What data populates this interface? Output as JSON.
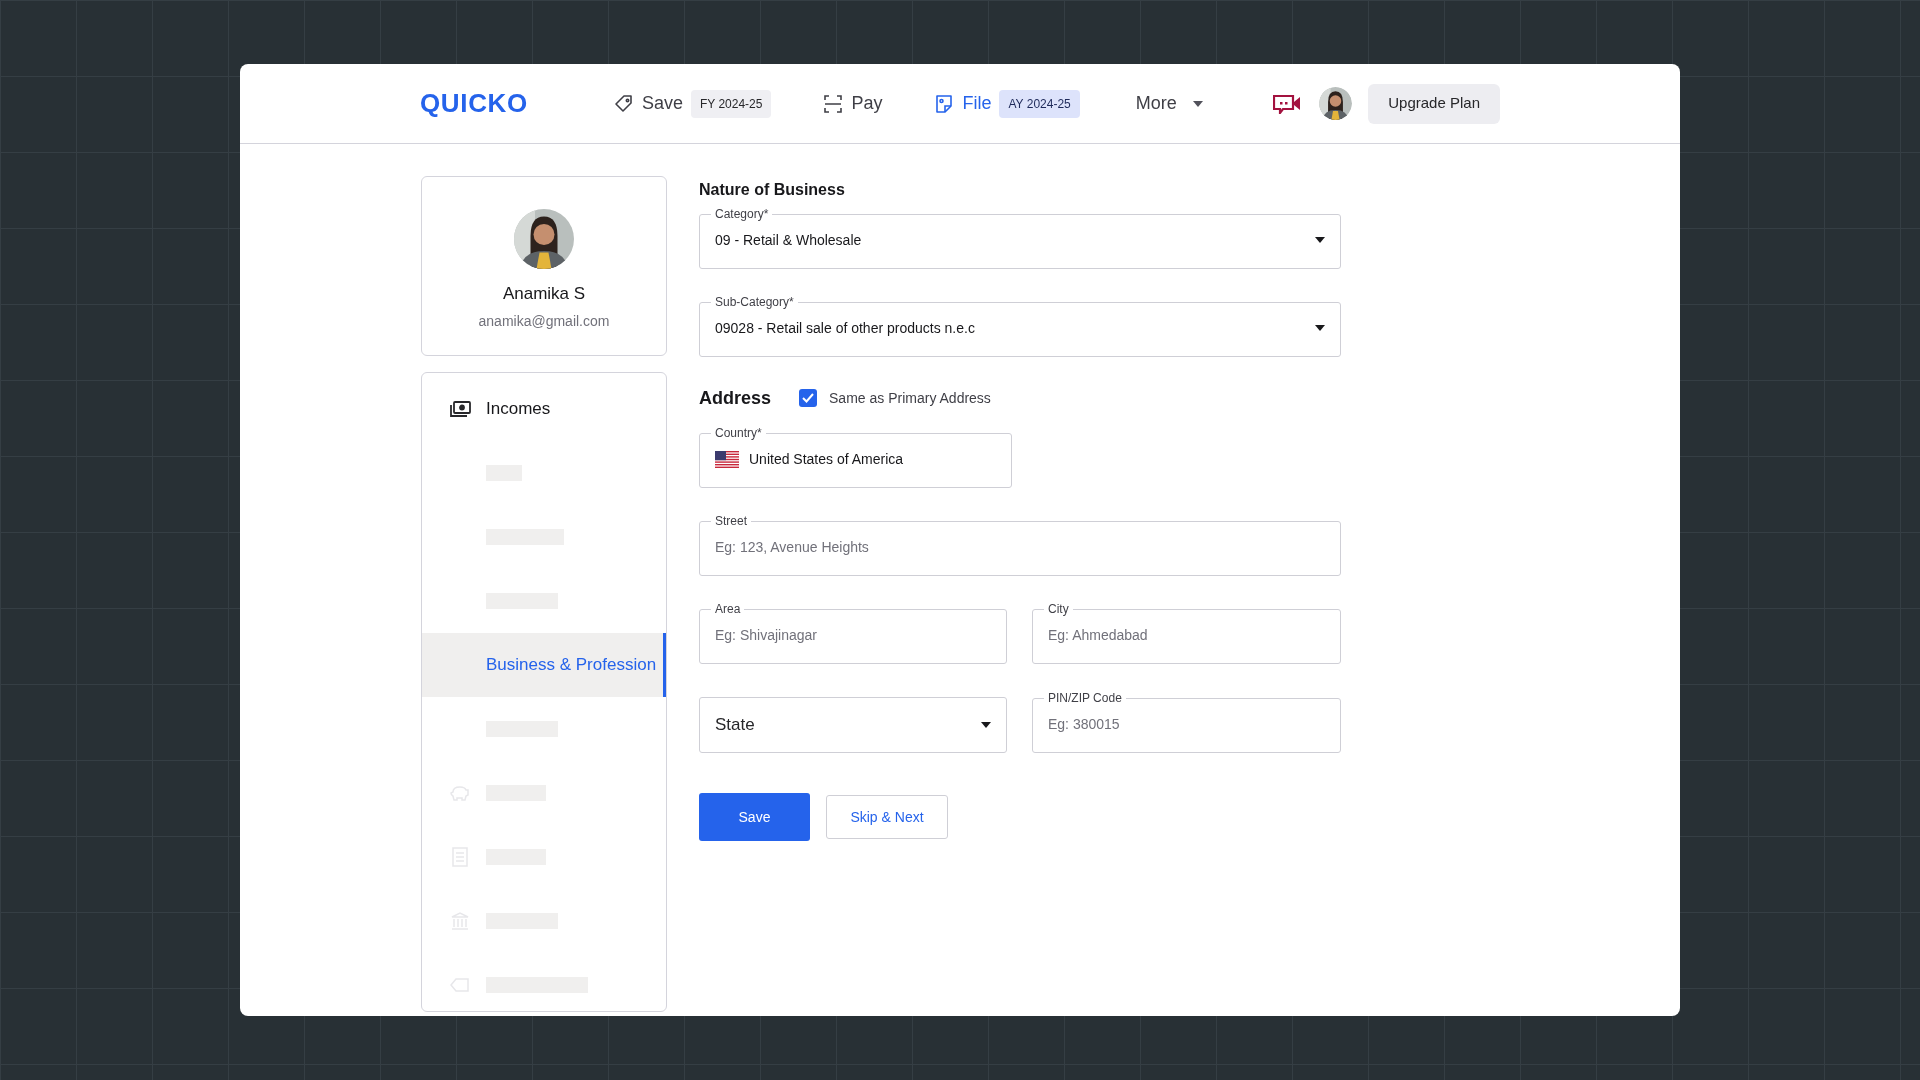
{
  "header": {
    "logo": "QUICKO",
    "nav": [
      {
        "kind": "link",
        "label": "Save",
        "badge": "FY 2024-25",
        "selected": false
      },
      {
        "kind": "link",
        "label": "Pay",
        "selected": false
      },
      {
        "kind": "link",
        "label": "File",
        "badge": "AY 2024-25",
        "selected": true
      },
      {
        "kind": "dropdown",
        "label": "More",
        "selected": false
      }
    ],
    "upgrade_button": "Upgrade Plan"
  },
  "profile": {
    "name": "Anamika S",
    "email": "anamika@gmail.com"
  },
  "sidebar": {
    "items": [
      {
        "kind": "header",
        "label": "Incomes"
      },
      {
        "kind": "placeholder",
        "selected": false
      },
      {
        "kind": "placeholder",
        "selected": false
      },
      {
        "kind": "placeholder",
        "selected": false
      },
      {
        "kind": "link",
        "label": "Business & Profession",
        "selected": true
      },
      {
        "kind": "placeholder",
        "selected": false
      },
      {
        "kind": "placeholder",
        "selected": false
      },
      {
        "kind": "placeholder",
        "selected": false
      },
      {
        "kind": "placeholder",
        "selected": false
      },
      {
        "kind": "placeholder",
        "selected": false
      }
    ]
  },
  "form": {
    "nature_title": "Nature of Business",
    "category": {
      "label": "Category*",
      "value": "09 - Retail & Wholesale"
    },
    "sub_category": {
      "label": "Sub-Category*",
      "value": "09028 - Retail sale of other products n.e.c"
    },
    "address_title": "Address",
    "same_as_primary": {
      "label": "Same as Primary Address",
      "checked": true
    },
    "country": {
      "label": "Country*",
      "value": "United States of America"
    },
    "street": {
      "label": "Street",
      "placeholder": "Eg: 123, Avenue Heights"
    },
    "area": {
      "label": "Area",
      "placeholder": "Eg: Shivajinagar"
    },
    "city": {
      "label": "City",
      "placeholder": "Eg: Ahmedabad"
    },
    "state": {
      "placeholder": "State"
    },
    "pin": {
      "label": "PIN/ZIP Code",
      "placeholder": "Eg: 380015"
    },
    "buttons": [
      {
        "kind": "primary",
        "label": "Save"
      },
      {
        "kind": "secondary",
        "label": "Skip & Next"
      }
    ]
  }
}
